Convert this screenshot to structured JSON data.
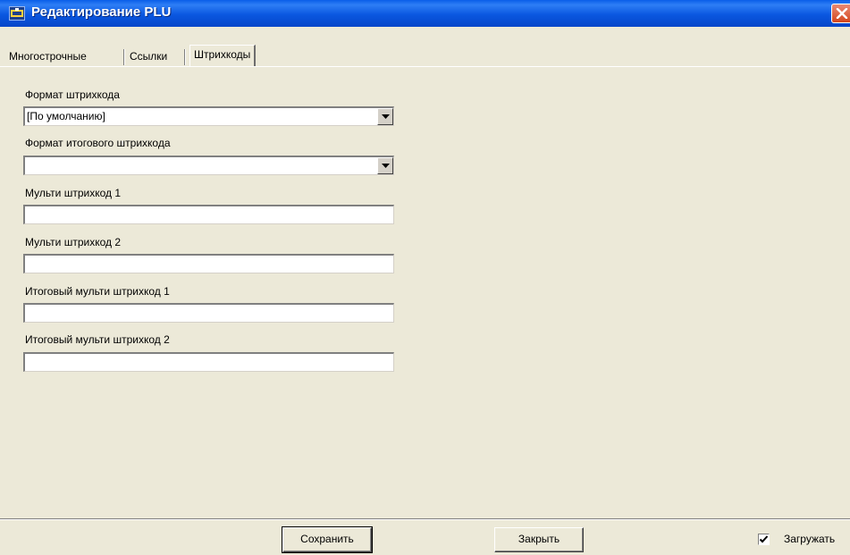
{
  "window": {
    "title": "Редактирование PLU"
  },
  "tabs": [
    {
      "label": "Многострочные",
      "active": false
    },
    {
      "label": "Ссылки",
      "active": false
    },
    {
      "label": "Штрихкоды",
      "active": true
    }
  ],
  "form": {
    "barcode_format": {
      "label": "Формат штрихкода",
      "value": "[По умолчанию]"
    },
    "total_barcode_format": {
      "label": "Формат итогового штрихкода",
      "value": ""
    },
    "multi_barcode_1": {
      "label": "Мульти штрихкод 1",
      "value": ""
    },
    "multi_barcode_2": {
      "label": "Мульти штрихкод 2",
      "value": ""
    },
    "total_multi_barcode_1": {
      "label": "Итоговый мульти штрихкод 1",
      "value": ""
    },
    "total_multi_barcode_2": {
      "label": "Итоговый мульти штрихкод 2",
      "value": ""
    }
  },
  "footer": {
    "save_label": "Сохранить",
    "close_label": "Закрыть",
    "load_label": "Загружать",
    "load_checked": true
  },
  "colors": {
    "titlebar": "#0a57e0",
    "window_bg": "#ece9d8",
    "close_button": "#d4461d"
  },
  "icons": {
    "title": "app-icon",
    "close": "close-icon",
    "dropdown": "chevron-down-icon",
    "check": "checkmark-icon"
  }
}
